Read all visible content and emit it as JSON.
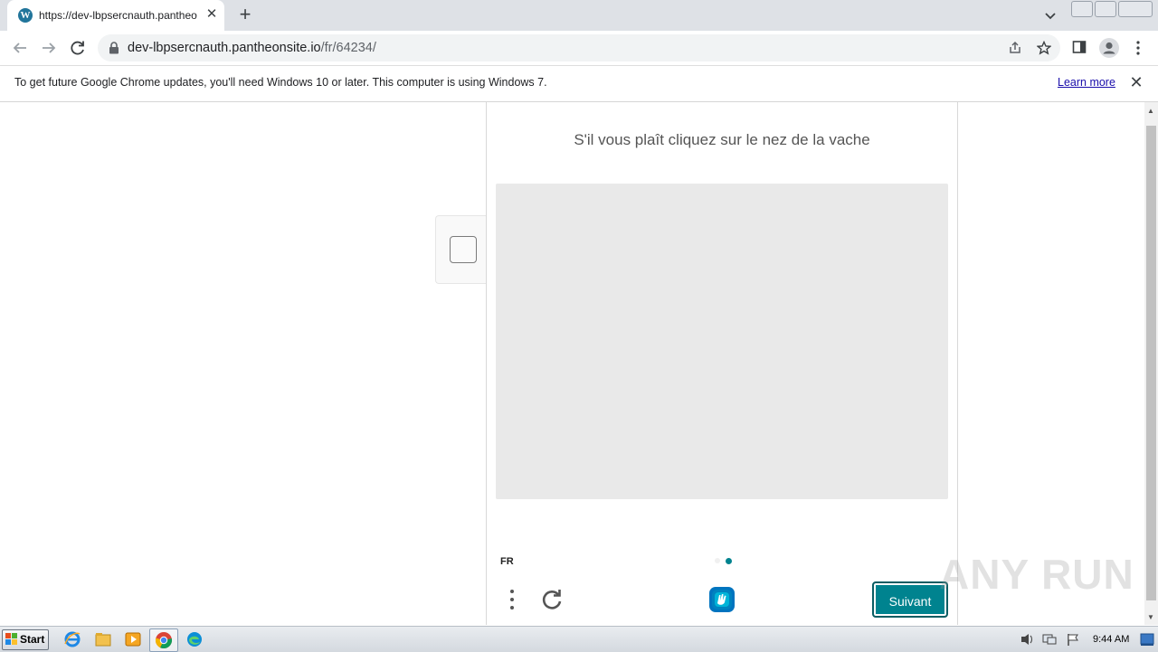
{
  "browser": {
    "tab": {
      "title": "https://dev-lbpsercnauth.pantheonsite.io/fr/64234/",
      "favicon": "wordpress-icon"
    },
    "url": {
      "host": "dev-lbpsercnauth.pantheonsite.io",
      "path": "/fr/64234/"
    }
  },
  "infobar": {
    "message": "To get future Google Chrome updates, you'll need Windows 10 or later. This computer is using Windows 7.",
    "learn_more": "Learn more"
  },
  "captcha": {
    "prompt": "S'il vous plaît cliquez sur le nez de la vache",
    "language": "FR",
    "next_button": "Suivant",
    "accent_color": "#00838f"
  },
  "watermark": "ANY RUN",
  "taskbar": {
    "start_label": "Start",
    "clock": "9:44 AM"
  }
}
